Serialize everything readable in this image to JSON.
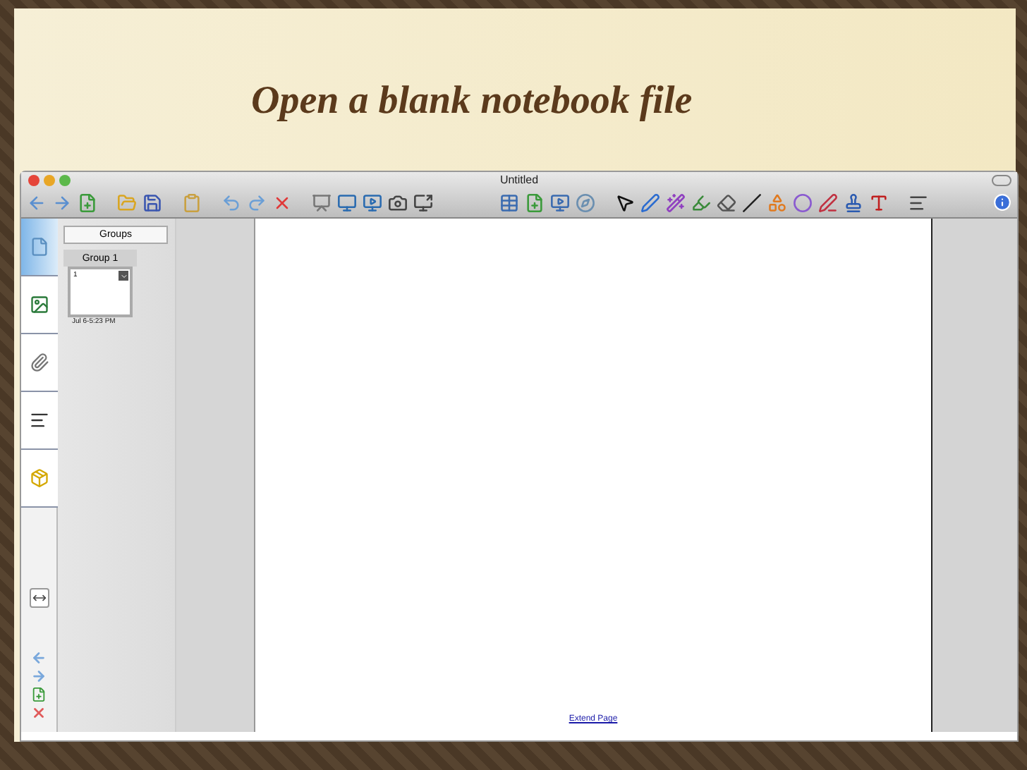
{
  "slide_title": "Open a blank notebook file",
  "window": {
    "title": "Untitled"
  },
  "sidebar_tabs": [
    {
      "kind": "pages",
      "selected": true
    },
    {
      "kind": "gallery",
      "selected": false
    },
    {
      "kind": "attachments",
      "selected": false
    },
    {
      "kind": "properties",
      "selected": false
    },
    {
      "kind": "addons",
      "selected": false
    }
  ],
  "groups_panel": {
    "header": "Groups",
    "group": "Group 1",
    "thumbnail": {
      "number": "1",
      "timestamp": "Jul 6-5:23 PM"
    }
  },
  "page": {
    "link": "Extend Page"
  }
}
